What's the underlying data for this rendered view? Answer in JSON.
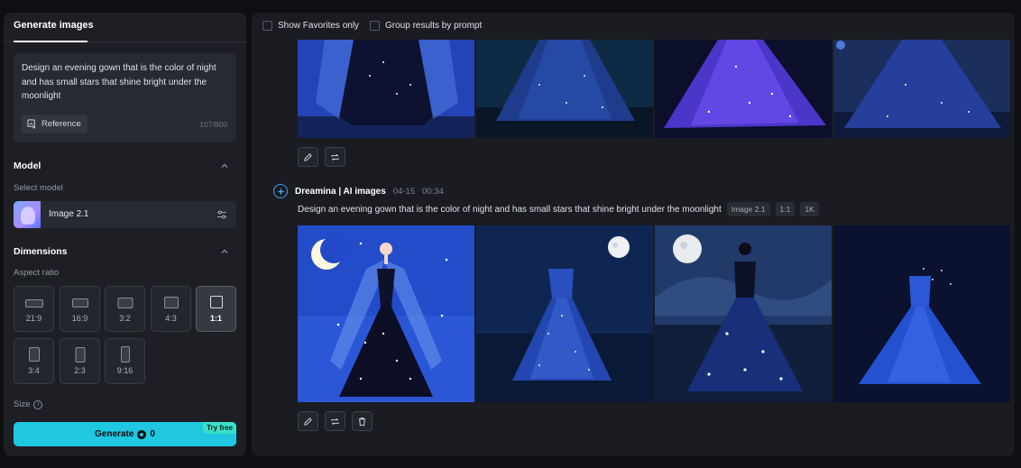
{
  "left_panel": {
    "tab_label": "Generate images",
    "prompt": {
      "text": "Design an evening gown that is the color of night and has small stars that shine bright under the moonlight",
      "reference_label": "Reference",
      "char_count": "107/800"
    },
    "model": {
      "section_title": "Model",
      "select_label": "Select model",
      "selected_model": "Image 2.1"
    },
    "dimensions": {
      "section_title": "Dimensions",
      "aspect_label": "Aspect ratio",
      "ratios": [
        "21:9",
        "16:9",
        "3:2",
        "4:3",
        "1:1",
        "3:4",
        "2:3",
        "9:16"
      ],
      "selected_ratio": "1:1",
      "size_label": "Size"
    },
    "generate": {
      "label": "Generate",
      "credits": "0",
      "badge": "Try free"
    }
  },
  "main": {
    "filters": {
      "favorites_label": "Show Favorites only",
      "group_label": "Group results by prompt"
    },
    "previous_batch": {
      "images": [
        "evening-gown-1",
        "evening-gown-2",
        "evening-gown-3",
        "evening-gown-4"
      ]
    },
    "current_batch": {
      "app_name": "Dreamina | AI images",
      "date": "04-15",
      "time": "00:34",
      "prompt": "Design an evening gown that is the color of night and has small stars that shine bright under the moonlight",
      "tags": [
        "Image 2.1",
        "1:1",
        "1K"
      ],
      "images": [
        "star-gown-crescent-moon",
        "strapless-gown-full-moon",
        "silhouette-gown-moon",
        "blue-gown-crescent"
      ]
    }
  },
  "colors": {
    "accent": "#1fc8e0",
    "panel": "#1d1f25",
    "background": "#0e0f12"
  }
}
